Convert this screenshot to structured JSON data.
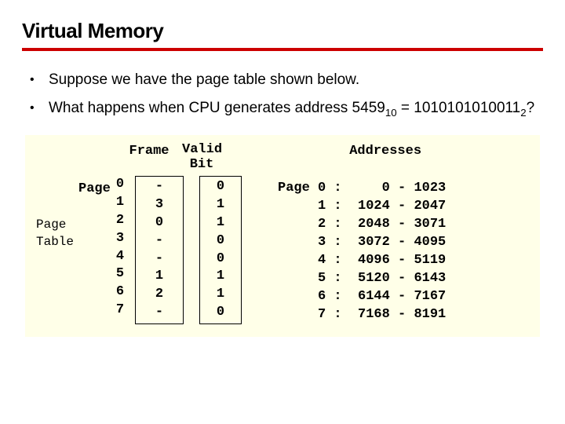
{
  "title": "Virtual Memory",
  "bullets": [
    {
      "text": "Suppose we have the page table shown below."
    },
    {
      "text_pre": "What happens when CPU generates address 5459",
      "sub1": "10",
      "mid": " = 1010101010011",
      "sub2": "2",
      "tail": "?"
    }
  ],
  "figure": {
    "page_table_label": "Page\nTable",
    "page_word": "Page",
    "frame_header": "Frame",
    "valid_header": "Valid\nBit",
    "addresses_header": "Addresses",
    "rows": [
      {
        "page": "0",
        "frame": "-",
        "valid": "0",
        "addr_lo": "0",
        "addr_hi": "1023"
      },
      {
        "page": "1",
        "frame": "3",
        "valid": "1",
        "addr_lo": "1024",
        "addr_hi": "2047"
      },
      {
        "page": "2",
        "frame": "0",
        "valid": "1",
        "addr_lo": "2048",
        "addr_hi": "3071"
      },
      {
        "page": "3",
        "frame": "-",
        "valid": "0",
        "addr_lo": "3072",
        "addr_hi": "4095"
      },
      {
        "page": "4",
        "frame": "-",
        "valid": "0",
        "addr_lo": "4096",
        "addr_hi": "5119"
      },
      {
        "page": "5",
        "frame": "1",
        "valid": "1",
        "addr_lo": "5120",
        "addr_hi": "6143"
      },
      {
        "page": "6",
        "frame": "2",
        "valid": "1",
        "addr_lo": "6144",
        "addr_hi": "7167"
      },
      {
        "page": "7",
        "frame": "-",
        "valid": "0",
        "addr_lo": "7168",
        "addr_hi": "8191"
      }
    ]
  }
}
